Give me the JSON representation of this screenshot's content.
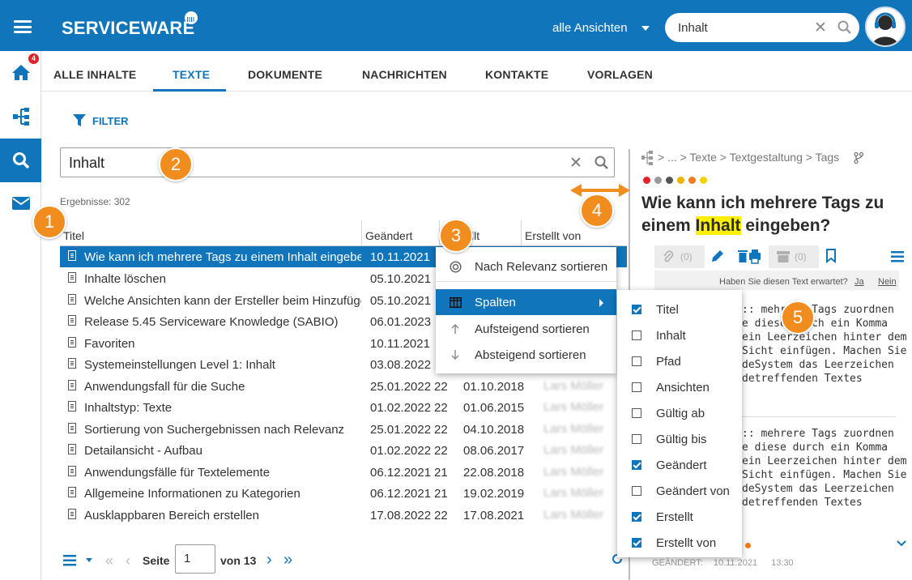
{
  "header": {
    "brand": "SERVICEWARE",
    "views_label": "alle Ansichten",
    "search_value": "Inhalt"
  },
  "rail": {
    "home_badge": "4"
  },
  "tabs": [
    "ALLE INHALTE",
    "TEXTE",
    "DOKUMENTE",
    "NACHRICHTEN",
    "KONTAKTE",
    "VORLAGEN"
  ],
  "active_tab": "TEXTE",
  "filter_label": "FILTER",
  "search": {
    "value": "Inhalt"
  },
  "results_label": "Ergebnisse: 302",
  "columns": [
    "Titel",
    "Geändert",
    "Erstellt",
    "Erstellt von"
  ],
  "column_partial": "llt",
  "rows": [
    {
      "title": "Wie kann ich mehrere Tags zu einem Inhalt eingeben?",
      "changed": "10.11.2021",
      "created": "",
      "author": "",
      "trunc": ""
    },
    {
      "title": "Inhalte löschen",
      "changed": "05.10.2021",
      "created": "",
      "author": "",
      "trunc": ""
    },
    {
      "title": "Welche Ansichten kann der Ersteller beim Hinzufügen auswählen?",
      "changed": "05.10.2021",
      "created": "",
      "author": "",
      "trunc": ""
    },
    {
      "title": "Release 5.45 Serviceware Knowledge (SABIO)",
      "changed": "06.01.2023",
      "created": "",
      "author": "",
      "trunc": ""
    },
    {
      "title": "Favoriten",
      "changed": "10.11.2021",
      "created": "",
      "author": "",
      "trunc": ""
    },
    {
      "title": "Systemeinstellungen Level 1: Inhalt",
      "changed": "03.08.2022",
      "created": "",
      "author": "",
      "trunc": ""
    },
    {
      "title": "Anwendungsfall für die Suche",
      "changed": "25.01.2022",
      "created": "01.10.2018",
      "author": "Lars Möller",
      "trunc": "22"
    },
    {
      "title": "Inhaltstyp: Texte",
      "changed": "01.02.2022",
      "created": "01.06.2015",
      "author": "Lars Möller",
      "trunc": "22"
    },
    {
      "title": "Sortierung von Suchergebnissen nach Relevanz",
      "changed": "25.01.2022",
      "created": "04.10.2018",
      "author": "Lars Möller",
      "trunc": "22"
    },
    {
      "title": "Detailansicht - Aufbau",
      "changed": "01.02.2022",
      "created": "08.06.2017",
      "author": "Lars Möller",
      "trunc": "22"
    },
    {
      "title": "Anwendungsfälle für Textelemente",
      "changed": "06.12.2021",
      "created": "22.08.2018",
      "author": "Lars Möller",
      "trunc": "21"
    },
    {
      "title": "Allgemeine Informationen zu Kategorien",
      "changed": "06.12.2021",
      "created": "19.02.2019",
      "author": "Lars Möller",
      "trunc": "21"
    },
    {
      "title": "Ausklappbaren Bereich erstellen",
      "changed": "17.08.2022",
      "created": "17.08.2021",
      "author": "Lars Möller",
      "trunc": "22"
    }
  ],
  "pager": {
    "page": "1",
    "of_label": "von 13",
    "page_label": "Seite"
  },
  "context_menu": {
    "items": [
      "Nach Relevanz sortieren",
      "Spalten",
      "Aufsteigend sortieren",
      "Absteigend sortieren"
    ],
    "selected": "Spalten"
  },
  "columns_submenu": [
    {
      "label": "Titel",
      "checked": true
    },
    {
      "label": "Inhalt",
      "checked": false
    },
    {
      "label": "Pfad",
      "checked": false
    },
    {
      "label": "Ansichten",
      "checked": false
    },
    {
      "label": "Gültig ab",
      "checked": false
    },
    {
      "label": "Gültig bis",
      "checked": false
    },
    {
      "label": "Geändert",
      "checked": true
    },
    {
      "label": "Geändert von",
      "checked": false
    },
    {
      "label": "Erstellt",
      "checked": true
    },
    {
      "label": "Erstellt von",
      "checked": true
    }
  ],
  "detail": {
    "breadcrumb": "> ... > Texte > Textgestaltung > Tags",
    "tag_colors": [
      "#e2222a",
      "#9a9a9a",
      "#555555",
      "#f0b400",
      "#f07c1e",
      "#f6d100"
    ],
    "title_before": "Wie kann ich mehrere Tags zu einem ",
    "title_highlight": "Inhalt",
    "title_after": " eingeben?",
    "attach_count": "(0)",
    "archive_count": "(0)",
    "rating_question": "Haben Sie diesen Text erwartet?",
    "rating_yes": "Ja",
    "rating_no": "Nein",
    "text_block_1": [
      ":: mehrere Tags zuordnen",
      "e diese durch ein Komma",
      "ein Leerzeichen hinter dem",
      "Sicht einfügen. Machen Sie",
      "deSystem das Leerzeichen",
      "detreffenden Textes"
    ],
    "text_block_2": [
      ":: mehrere Tags zuordnen",
      "e diese durch ein Komma",
      "ein Leerzeichen hinter dem",
      "Sicht einfügen. Machen Sie",
      "deSystem das Leerzeichen",
      "detreffenden Textes"
    ],
    "footer_label": "GEÄNDERT:",
    "footer_date": "10.11.2021",
    "footer_time": "13:30"
  },
  "callouts": [
    "1",
    "2",
    "3",
    "4",
    "5"
  ],
  "colors": {
    "brand_blue": "#1075bb",
    "callout": "#f18d1e",
    "highlight": "#ffef00",
    "badge": "#e2222a"
  }
}
